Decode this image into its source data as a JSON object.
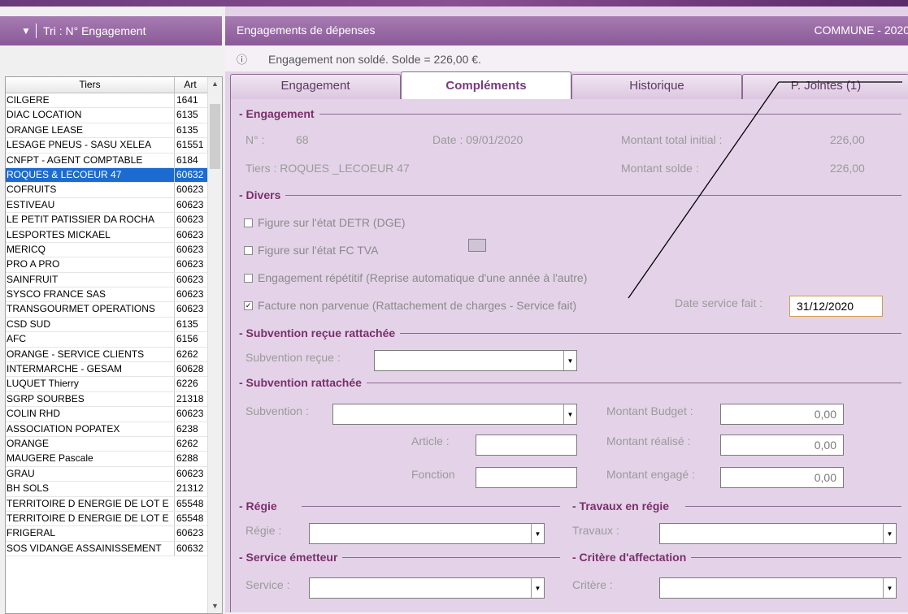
{
  "left": {
    "sort_label": "Tri : N° Engagement",
    "columns": [
      "Tiers",
      "Art"
    ],
    "rows": [
      [
        "CILGERE",
        "1641"
      ],
      [
        "DIAC LOCATION",
        "6135"
      ],
      [
        "ORANGE LEASE",
        "6135"
      ],
      [
        "LESAGE PNEUS - SASU XELEA",
        "61551"
      ],
      [
        "CNFPT - AGENT COMPTABLE",
        "6184"
      ],
      [
        "ROQUES & LECOEUR 47",
        "60632"
      ],
      [
        "COFRUITS",
        "60623"
      ],
      [
        "ESTIVEAU",
        "60623"
      ],
      [
        "LE PETIT PATISSIER DA ROCHA",
        "60623"
      ],
      [
        "LESPORTES MICKAEL",
        "60623"
      ],
      [
        "MERICQ",
        "60623"
      ],
      [
        "PRO A PRO",
        "60623"
      ],
      [
        "SAINFRUIT",
        "60623"
      ],
      [
        "SYSCO FRANCE SAS",
        "60623"
      ],
      [
        "TRANSGOURMET OPERATIONS",
        "60623"
      ],
      [
        "CSD SUD",
        "6135"
      ],
      [
        "AFC",
        "6156"
      ],
      [
        "ORANGE - SERVICE CLIENTS",
        "6262"
      ],
      [
        "INTERMARCHE - GESAM",
        "60628"
      ],
      [
        "LUQUET Thierry",
        "6226"
      ],
      [
        "SGRP SOURBES",
        "21318"
      ],
      [
        "COLIN RHD",
        "60623"
      ],
      [
        "ASSOCIATION POPATEX",
        "6238"
      ],
      [
        "ORANGE",
        "6262"
      ],
      [
        "MAUGERE Pascale",
        "6288"
      ],
      [
        "GRAU",
        "60623"
      ],
      [
        "BH SOLS",
        "21312"
      ],
      [
        "TERRITOIRE D ENERGIE DE LOT E",
        "65548"
      ],
      [
        "TERRITOIRE D ENERGIE DE LOT E",
        "65548"
      ],
      [
        "FRIGERAL",
        "60623"
      ],
      [
        "SOS VIDANGE ASSAINISSEMENT",
        "60632"
      ]
    ],
    "selected_index": 5
  },
  "right": {
    "title": "Engagements de dépenses",
    "commune": "COMMUNE  - 2020",
    "info": "Engagement non soldé. Solde = 226,00 €.",
    "tabs": [
      "Engagement",
      "Compléments",
      "Historique",
      "P. Jointes (1)"
    ],
    "active_tab": 1
  },
  "form": {
    "sec_engagement": "- Engagement",
    "no_label": "N° :",
    "no_value": "68",
    "date_label": "Date : 09/01/2020",
    "mt_initial_label": "Montant total initial :",
    "mt_initial_value": "226,00",
    "tiers_label": "Tiers : ROQUES _LECOEUR 47",
    "mt_solde_label": "Montant solde :",
    "mt_solde_value": "226,00",
    "sec_divers": "- Divers",
    "chk_detr": "Figure sur l'état DETR (DGE)",
    "chk_fctva": "Figure sur l'état FC TVA",
    "chk_repetitif": "Engagement répétitif (Reprise automatique d'une année à l'autre)",
    "chk_facture": "Facture non parvenue (Rattachement de charges - Service fait)",
    "date_service_label": "Date service fait :",
    "date_service_value": "31/12/2020",
    "sec_sub_recue": "- Subvention reçue rattachée",
    "sub_recue_label": "Subvention reçue :",
    "sec_sub_ratt": "- Subvention rattachée",
    "subvention_label": "Subvention :",
    "mt_budget_label": "Montant Budget :",
    "mt_budget_value": "0,00",
    "article_label": "Article :",
    "mt_realise_label": "Montant réalisé :",
    "mt_realise_value": "0,00",
    "fonction_label": "Fonction",
    "mt_engage_label": "Montant engagé :",
    "mt_engage_value": "0,00",
    "sec_regie": "- Régie",
    "regie_label": "Régie :",
    "sec_travaux": "- Travaux en régie",
    "travaux_label": "Travaux :",
    "sec_service": "- Service émetteur",
    "service_label": "Service :",
    "sec_critere": "- Critère d'affectation",
    "critere_label": "Critère :"
  }
}
